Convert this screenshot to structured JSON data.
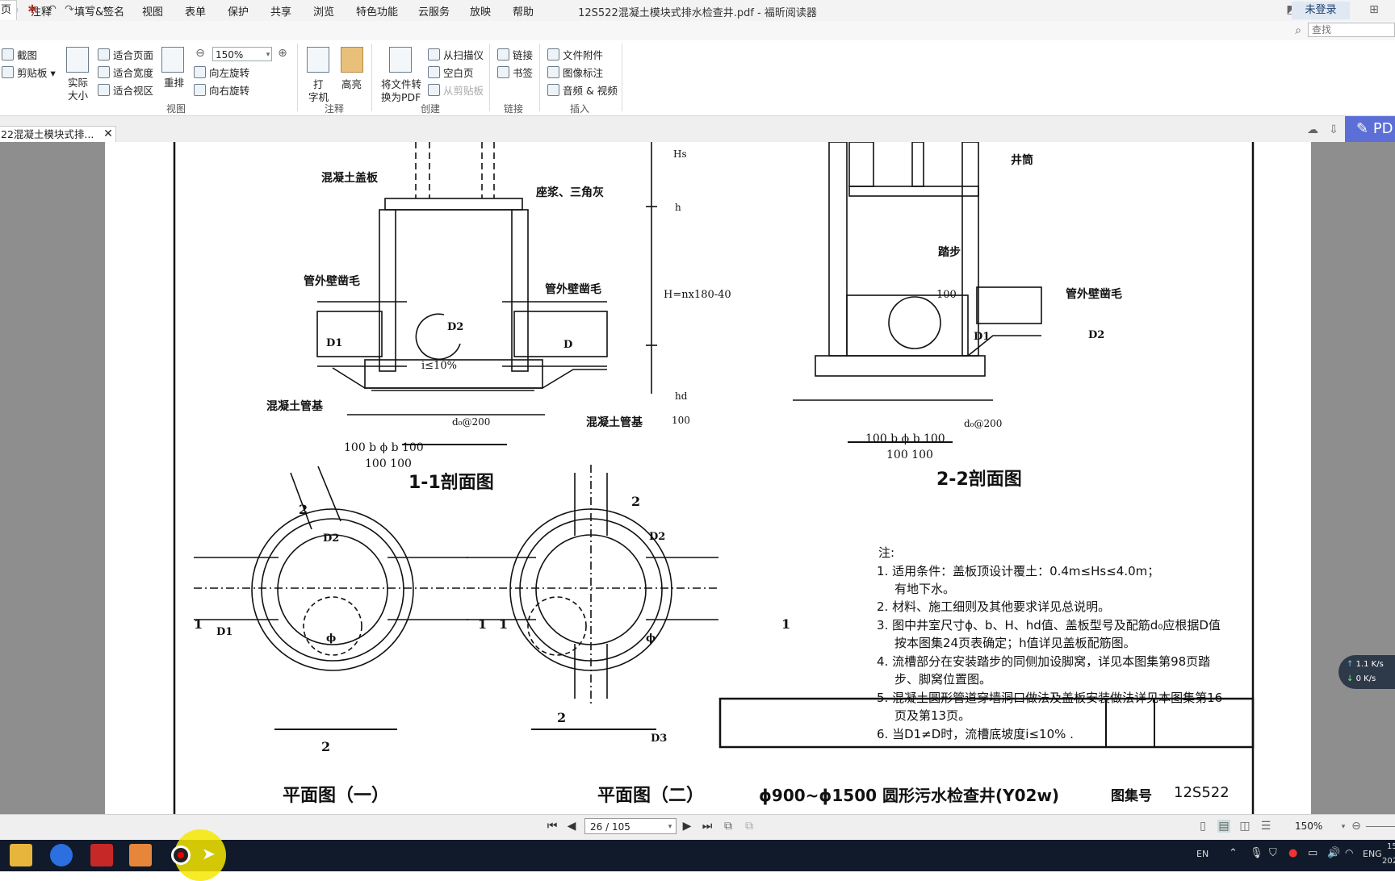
{
  "window": {
    "title": "12S522混凝土模块式排水检查井.pdf - 福昕阅读器",
    "login_label": "未登录"
  },
  "menu": {
    "active": "页",
    "items": [
      "注释",
      "填写&签名",
      "视图",
      "表单",
      "保护",
      "共享",
      "浏览",
      "特色功能",
      "云服务",
      "放映",
      "帮助"
    ]
  },
  "search": {
    "placeholder": "查找"
  },
  "ribbon": {
    "clip": {
      "screenshot": "截图",
      "clipboard": "剪贴板"
    },
    "view": {
      "actual_line1": "实际",
      "actual_line2": "大小",
      "fit_page": "适合页面",
      "fit_width": "适合宽度",
      "fit_visible": "适合视区",
      "reflow": "重排",
      "zoom_value": "150%",
      "rotate_left": "向左旋转",
      "rotate_right": "向右旋转",
      "group": "视图"
    },
    "annot": {
      "type_line1": "打",
      "type_line2": "字机",
      "highlight": "高亮",
      "group": "注释"
    },
    "create": {
      "convert_line1": "将文件转",
      "convert_line2": "换为PDF",
      "from_scanner": "从扫描仪",
      "blank_page": "空白页",
      "from_clipboard": "从剪贴板",
      "group": "创建"
    },
    "links": {
      "link": "链接",
      "bookmark": "书签",
      "group": "链接"
    },
    "insert": {
      "attachment": "文件附件",
      "image_annot": "图像标注",
      "audio_video": "音频 & 视频",
      "group": "插入"
    }
  },
  "doc_tab": {
    "label": "22混凝土模块式排..."
  },
  "pdf_button": {
    "label": "PD"
  },
  "drawing": {
    "labels": {
      "cover_slab": "混凝土盖板",
      "mortar": "座浆、三角灰",
      "chisel_left": "管外壁凿毛",
      "chisel_mid": "管外壁凿毛",
      "chisel_right": "管外壁凿毛",
      "base_left": "混凝土管基",
      "base_right": "混凝土管基",
      "slope": "i≤10%",
      "d1": "D1",
      "d2": "D2",
      "d": "D",
      "d0_left": "d₀@200",
      "d0_right": "d₀@200",
      "shaft": "井筒",
      "step": "踏步",
      "dim100": "100",
      "hs": "Hs",
      "h": "h",
      "H": "H=nx180-40",
      "hd": "hd",
      "hundred": "100",
      "dims_left_top": "100  b        ϕ        b  100",
      "dims_left_bot": "100                      100",
      "dims_right_top": "100  b        ϕ        b  100",
      "dims_right_bot": "100                      100",
      "phi": "ϕ",
      "b": "b",
      "d3": "D3",
      "sec1": "1",
      "sec2": "2"
    },
    "captions": {
      "sec11": "1-1剖面图",
      "sec22": "2-2剖面图",
      "plan1": "平面图（一）",
      "plan2": "平面图（二）"
    },
    "notes": {
      "heading": "注:",
      "n1a": "1. 适用条件：盖板顶设计覆土：0.4m≤Hs≤4.0m；",
      "n1b": "有地下水。",
      "n2": "2. 材料、施工细则及其他要求详见总说明。",
      "n3a": "3. 图中井室尺寸ϕ、b、H、hd值、盖板型号及配筋d₀应根据D值",
      "n3b": "按本图集24页表确定；h值详见盖板配筋图。",
      "n4a": "4. 流槽部分在安装踏步的同侧加设脚窝，详见本图集第98页踏",
      "n4b": "步、脚窝位置图。",
      "n5a": "5. 混凝土圆形管道穿墙洞口做法及盖板安装做法详见本图集第16",
      "n5b": "页及第13页。",
      "n6": "6. 当D1≠D时，流槽底坡度i≤10% ."
    },
    "title_block": {
      "title": "ϕ900~ϕ1500  圆形污水检查井(Y02w)",
      "atlas_label": "图集号",
      "atlas_no": "12S522"
    }
  },
  "status": {
    "page_field": "26 / 105",
    "zoom": "150%"
  },
  "network": {
    "up": "1.1 K/s",
    "down": "0 K/s"
  },
  "tray": {
    "ime": "EN",
    "lang": "ENG",
    "time": "15",
    "date": "202"
  }
}
